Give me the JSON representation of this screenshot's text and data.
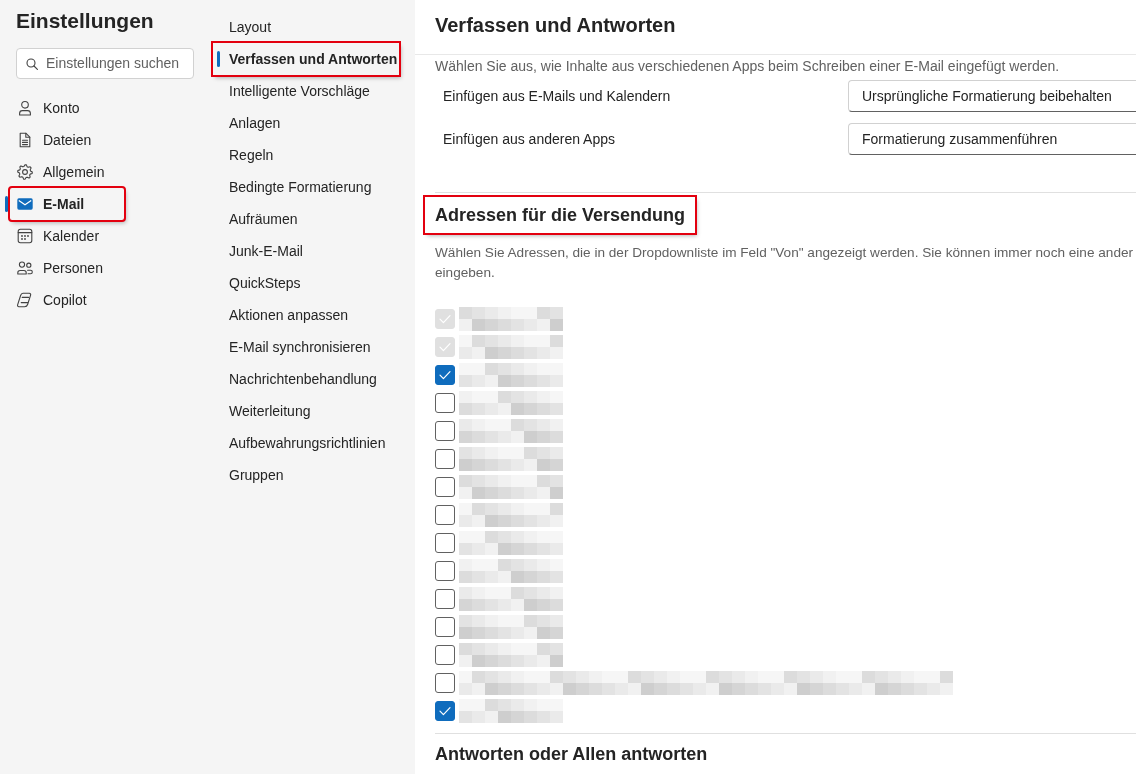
{
  "sidebar": {
    "title": "Einstellungen",
    "search": {
      "placeholder": "Einstellungen suchen"
    },
    "items": [
      {
        "label": "Konto",
        "selected": false,
        "highlighted": false
      },
      {
        "label": "Dateien",
        "selected": false,
        "highlighted": false
      },
      {
        "label": "Allgemein",
        "selected": false,
        "highlighted": false
      },
      {
        "label": "E-Mail",
        "selected": true,
        "highlighted": true
      },
      {
        "label": "Kalender",
        "selected": false,
        "highlighted": false
      },
      {
        "label": "Personen",
        "selected": false,
        "highlighted": false
      },
      {
        "label": "Copilot",
        "selected": false,
        "highlighted": false
      }
    ]
  },
  "category_nav": {
    "items": [
      {
        "label": "Layout",
        "selected": false,
        "highlighted": false
      },
      {
        "label": "Verfassen und Antworten",
        "selected": true,
        "highlighted": true
      },
      {
        "label": "Intelligente Vorschläge",
        "selected": false,
        "highlighted": false
      },
      {
        "label": "Anlagen",
        "selected": false,
        "highlighted": false
      },
      {
        "label": "Regeln",
        "selected": false,
        "highlighted": false
      },
      {
        "label": "Bedingte Formatierung",
        "selected": false,
        "highlighted": false
      },
      {
        "label": "Aufräumen",
        "selected": false,
        "highlighted": false
      },
      {
        "label": "Junk-E-Mail",
        "selected": false,
        "highlighted": false
      },
      {
        "label": "QuickSteps",
        "selected": false,
        "highlighted": false
      },
      {
        "label": "Aktionen anpassen",
        "selected": false,
        "highlighted": false
      },
      {
        "label": "E-Mail synchronisieren",
        "selected": false,
        "highlighted": false
      },
      {
        "label": "Nachrichtenbehandlung",
        "selected": false,
        "highlighted": false
      },
      {
        "label": "Weiterleitung",
        "selected": false,
        "highlighted": false
      },
      {
        "label": "Aufbewahrungsrichtlinien",
        "selected": false,
        "highlighted": false
      },
      {
        "label": "Gruppen",
        "selected": false,
        "highlighted": false
      }
    ]
  },
  "content": {
    "title": "Verfassen und Antworten",
    "intro": "Wählen Sie aus, wie Inhalte aus verschiedenen Apps beim Schreiben einer E-Mail eingefügt werden.",
    "paste_settings": [
      {
        "label": "Einfügen aus E-Mails und Kalendern",
        "value": "Ursprüngliche Formatierung beibehalten"
      },
      {
        "label": "Einfügen aus anderen Apps",
        "value": "Formatierung zusammenführen"
      }
    ],
    "sections": [
      {
        "heading": "Adressen für die Versendung",
        "highlighted": true,
        "description_lines": [
          "Wählen Sie Adressen, die in der Dropdownliste im Feld \"Von\" angezeigt werden. Sie können immer noch eine ander",
          "eingeben."
        ],
        "addresses": [
          {
            "kind": "short",
            "checked": true,
            "disabled": true
          },
          {
            "kind": "short",
            "checked": true,
            "disabled": true
          },
          {
            "kind": "short",
            "checked": true,
            "disabled": false
          },
          {
            "kind": "short",
            "checked": false,
            "disabled": false
          },
          {
            "kind": "short",
            "checked": false,
            "disabled": false
          },
          {
            "kind": "short",
            "checked": false,
            "disabled": false
          },
          {
            "kind": "short",
            "checked": false,
            "disabled": false
          },
          {
            "kind": "short",
            "checked": false,
            "disabled": false
          },
          {
            "kind": "short",
            "checked": false,
            "disabled": false
          },
          {
            "kind": "short",
            "checked": false,
            "disabled": false
          },
          {
            "kind": "short",
            "checked": false,
            "disabled": false
          },
          {
            "kind": "short",
            "checked": false,
            "disabled": false
          },
          {
            "kind": "short",
            "checked": false,
            "disabled": false
          },
          {
            "kind": "long",
            "checked": false,
            "disabled": false
          },
          {
            "kind": "short",
            "checked": true,
            "disabled": false
          }
        ]
      },
      {
        "heading": "Antworten oder Allen antworten",
        "highlighted": false
      }
    ]
  }
}
